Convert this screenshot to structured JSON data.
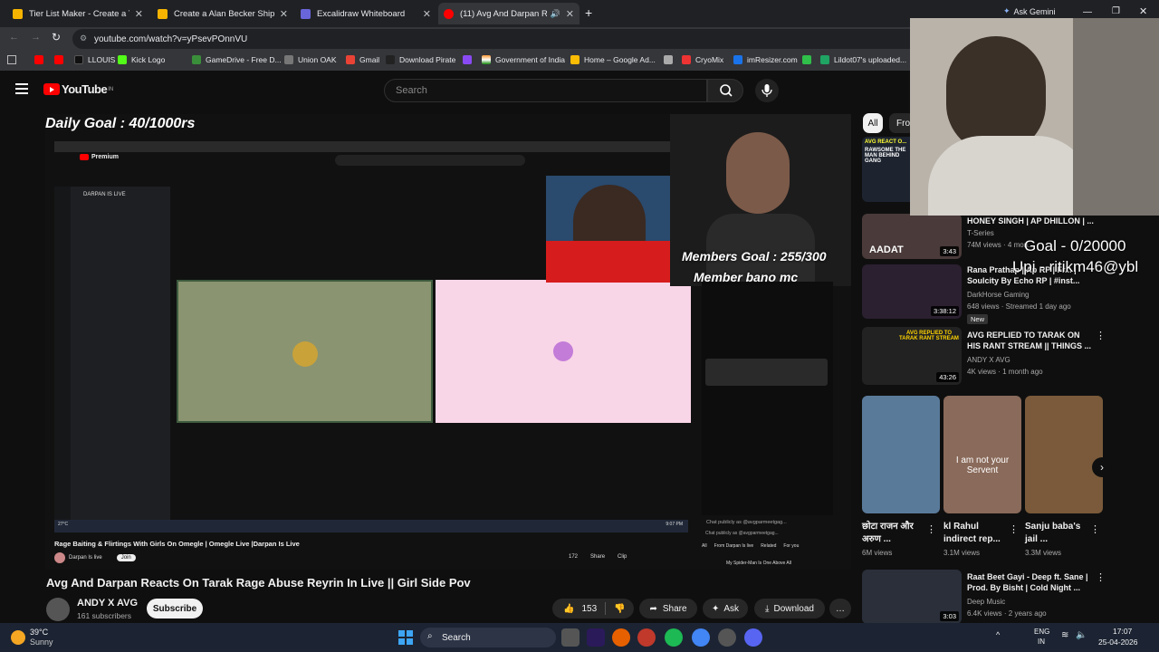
{
  "browser": {
    "tabs": [
      {
        "label": "Tier List Maker - Create a Tier L",
        "favicon_color": "#f6b400"
      },
      {
        "label": "Create a Alan Becker Ships Tier",
        "favicon_color": "#f6b400"
      },
      {
        "label": "Excalidraw Whiteboard",
        "favicon_color": "#6965db"
      },
      {
        "label": "(11) Avg And Darpan React",
        "favicon_color": "#ff0000"
      }
    ],
    "url": "youtube.com/watch?v=yPsevPOnnVU",
    "ask_gemini": "Ask Gemini",
    "bookmarks": [
      "LLOUIS",
      "Kick Logo",
      "GameDrive - Free D...",
      "Union OAK",
      "Gmail",
      "Download Pirate",
      "Government of India",
      "Home – Google Ad...",
      "CryoMix",
      "imResizer.com",
      "Lildot07's uploaded..."
    ]
  },
  "youtube": {
    "logo_text": "YouTube",
    "logo_sup": "IN",
    "search_placeholder": "Search"
  },
  "video": {
    "overlay_daily_goal": "Daily Goal : 40/1000rs",
    "overlay_members_goal": "Members Goal : 255/300",
    "overlay_member_bano": "Member bano mc",
    "overlay_goal_right": "Goal - 0/20000",
    "overlay_upi": "Upi - ritikm46@ybl",
    "inner_title": "Rage Baiting & Flirtings With Girls On Omegle | Omegle Live |Darpan Is Live",
    "inner_channel": "Darpan Is live",
    "inner_join": "Join",
    "inner_premium": "Premium",
    "inner_live_label": "DARPAN IS LIVE",
    "inner_likes": "172",
    "inner_share": "Share",
    "inner_clip": "Clip",
    "inner_chat_tabs": [
      "All",
      "From Darpan Is live",
      "Related",
      "For you"
    ],
    "inner_chat_footer": "Chat publicly as @avgparmeetgag...",
    "inner_next": "My Spider-Man Is One Above All",
    "inner_clock_temp": "27°C",
    "inner_clock_time": "9:07 PM"
  },
  "watch": {
    "title": "Avg And Darpan Reacts On Tarak Rage Abuse Reyrin In Live || Girl Side Pov",
    "channel": "ANDY X AVG",
    "subscribers": "161 subscribers",
    "subscribe_label": "Subscribe",
    "likes": "153",
    "share_label": "Share",
    "ask_label": "Ask",
    "download_label": "Download",
    "more": "…"
  },
  "sidebar": {
    "chips": [
      "All",
      "Fro"
    ],
    "items": [
      {
        "title": "HONEY SINGH | AP DHILLON | ...",
        "channel": "T-Series",
        "meta": "74M views · 4 mon...",
        "duration": "3:43",
        "thumb_text": "AADAT"
      },
      {
        "title": "Rana Prathap | Ap RP | Fr... | Soulcity By Echo RP | #inst...",
        "channel": "DarkHorse Gaming",
        "meta": "648 views · Streamed 1 day ago",
        "duration": "3:38:12",
        "badge": "New"
      },
      {
        "title": "AVG REPLIED TO TARAK ON HIS RANT STREAM || THINGS ...",
        "channel": "ANDY X AVG",
        "meta": "4K views · 1 month ago",
        "duration": "43:26",
        "thumb_text": "AVG REPLIED TO TARAK RANT STREAM"
      },
      {
        "title": "Raat Beet Gayi - Deep ft. Sane | Prod. By Bisht | Cold Night ...",
        "channel": "Deep Music",
        "meta": "6.4K views · 2 years ago",
        "duration": "3:03"
      }
    ],
    "shorts": [
      {
        "title": "छोटा राजन और अरुण ...",
        "views": "6M views"
      },
      {
        "title": "kl Rahul indirect rep...",
        "views": "3.1M views",
        "overlay": "I am not your Servent"
      },
      {
        "title": "Sanju baba's jail ...",
        "views": "3.3M views"
      }
    ],
    "top_thumb_text": "AVG REACT O...",
    "top_thumb_text2": "RAWSOME THE MAN BEHIND GANG"
  },
  "taskbar": {
    "temp": "39°C",
    "weather": "Sunny",
    "search": "Search",
    "lang": "ENG",
    "region": "IN",
    "time": "17:07",
    "date": "25-04-2026"
  }
}
